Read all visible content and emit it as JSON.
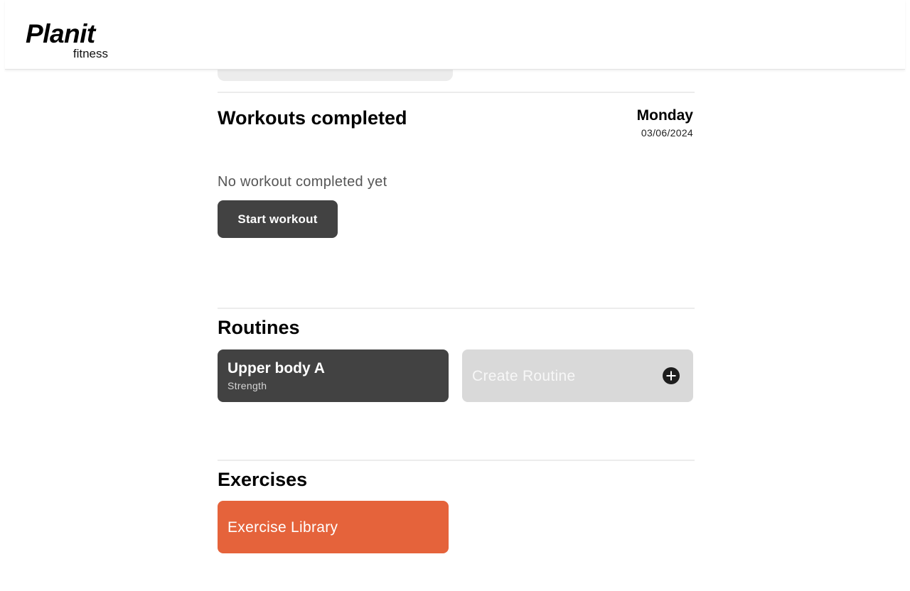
{
  "brand": {
    "name": "Planit",
    "sub": "fitness"
  },
  "workouts": {
    "title": "Workouts completed",
    "day": "Monday",
    "date": "03/06/2024",
    "empty_text": "No workout completed yet",
    "start_button": "Start workout"
  },
  "routines": {
    "title": "Routines",
    "items": [
      {
        "name": "Upper body A",
        "type": "Strength"
      }
    ],
    "create_label": "Create Routine",
    "create_icon": "plus-circle-icon"
  },
  "exercises": {
    "title": "Exercises",
    "library_label": "Exercise Library",
    "library_color": "#e5633b"
  },
  "colors": {
    "dark_card": "#424242",
    "create_card": "#d9d9d9",
    "accent": "#e5633b"
  }
}
